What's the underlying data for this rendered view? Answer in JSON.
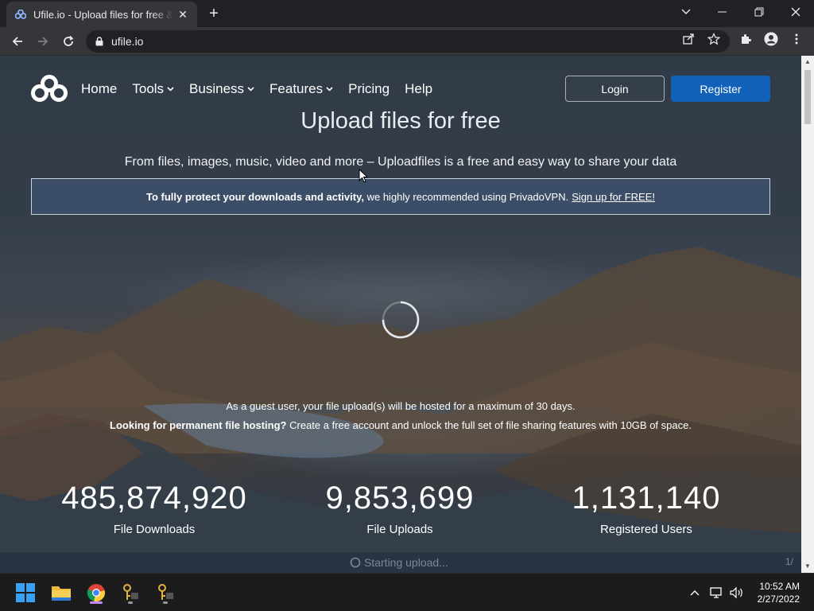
{
  "browser": {
    "tab_title": "Ufile.io - Upload files for free & share",
    "url": "ufile.io"
  },
  "site": {
    "nav": {
      "home": "Home",
      "tools": "Tools",
      "business": "Business",
      "features": "Features",
      "pricing": "Pricing",
      "help": "Help"
    },
    "login": "Login",
    "register": "Register",
    "title": "Upload files for free",
    "subtitle": "From files, images, music, video and more – Uploadfiles is a free and easy way to share your data",
    "vpn": {
      "pre": "To fully protect your downloads and activity,",
      "bold": "To fully protect your downloads and activity,",
      "rest": "we highly recommended using PrivadoVPN.",
      "link": "Sign up for FREE!"
    },
    "guest_note": "As a guest user, your file upload(s) will be hosted for a maximum of 30 days.",
    "perm_bold": "Looking for permanent file hosting?",
    "perm_rest": "Create a free account and unlock the full set of file sharing features with 10GB of space.",
    "stats": [
      {
        "value": "485,874,920",
        "label": "File Downloads"
      },
      {
        "value": "9,853,699",
        "label": "File Uploads"
      },
      {
        "value": "1,131,140",
        "label": "Registered Users"
      }
    ],
    "upload_status": "Starting upload...",
    "upload_count": "1/"
  },
  "taskbar": {
    "time": "10:52 AM",
    "date": "2/27/2022"
  },
  "colors": {
    "register_bg": "#1261b8",
    "chrome_dark": "#202124",
    "chrome_toolbar": "#35363a"
  }
}
